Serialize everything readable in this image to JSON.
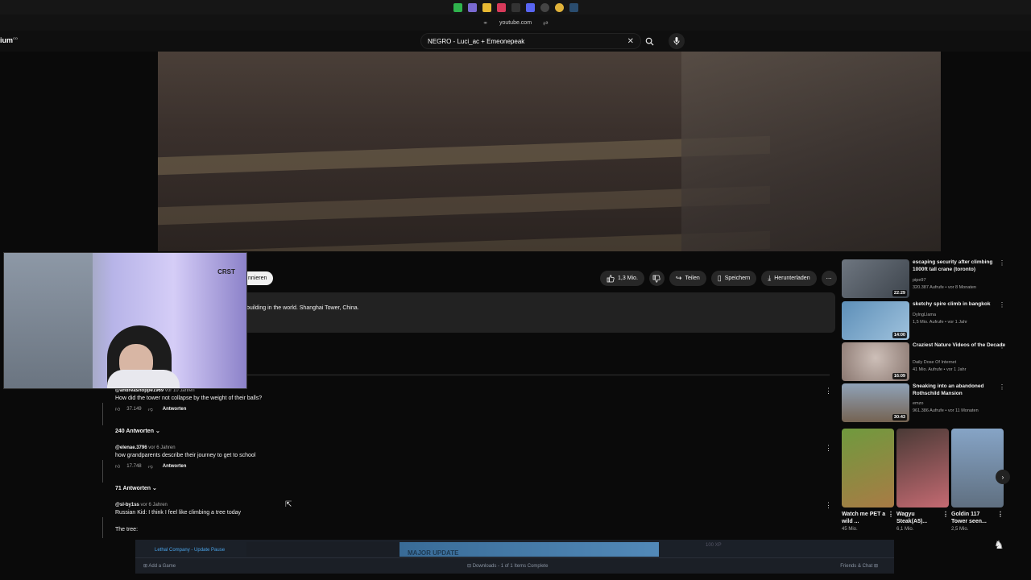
{
  "browser": {
    "url": "youtube.com"
  },
  "header": {
    "logo_fragment": "ium",
    "logo_sup": "CO",
    "search_query": "NEGRO - Luci_ac + Emeonepeak"
  },
  "actions": {
    "subscribe_label": "nnieren",
    "likes": "1,3 Mio.",
    "share": "Teilen",
    "save": "Speichern",
    "download": "Herunterladen"
  },
  "description": "building in the world. Shanghai Tower, China.",
  "webcam": {
    "logo_text": "CRST"
  },
  "comments": [
    {
      "author": "@andreasnoppe1969",
      "time": "vor 10 Jahren",
      "text": "How did the tower not collapse by the weight of their balls?",
      "likes": "37.149",
      "reply": "Antworten",
      "replies": "240 Antworten"
    },
    {
      "author": "@elenae.3796",
      "time": "vor 6 Jahren",
      "text": "how grandparents describe their journey to get to school",
      "likes": "17.748",
      "reply": "Antworten",
      "replies": "71 Antworten"
    },
    {
      "author": "@sl-by1ss",
      "time": "vor 6 Jahren",
      "text": "Russian Kid: I think I feel like climbing a tree today",
      "text2": "The tree:"
    }
  ],
  "sidebar": [
    {
      "title": "escaping security after climbing 1000ft tall crane (toronto)",
      "channel": "pipe97",
      "meta": "320.387 Aufrufe • vor 8 Monaten",
      "duration": "22:29",
      "colors": [
        "#6e7680",
        "#3d444c"
      ]
    },
    {
      "title": "sketchy spire climb in bangkok",
      "channel": "DylngLlama",
      "meta": "1,5 Mio. Aufrufe • vor 1 Jahr",
      "duration": "14:00",
      "colors": [
        "#5d8fb8",
        "#9fc2dd"
      ]
    },
    {
      "title": "Craziest Nature Videos of the Decade",
      "channel": "Daily Dose Of Internet",
      "meta": "41 Mio. Aufrufe • vor 1 Jahr",
      "duration": "16:09",
      "colors": [
        "#cdbfb8",
        "#8a7770"
      ]
    },
    {
      "title": "Sneaking into an abandoned Rothschild Mansion",
      "channel": "emzo",
      "meta": "961.386 Aufrufe • vor 11 Monaten",
      "duration": "30:43",
      "colors": [
        "#8fa2b8",
        "#756352"
      ]
    }
  ],
  "shorts": [
    {
      "title": "Watch me PET a wild ...",
      "views": "45 Mio.",
      "colors": [
        "#6f9a3e",
        "#a97b45"
      ]
    },
    {
      "title": "Wagyu Steak(A5)...",
      "views": "6,1 Mio.",
      "colors": [
        "#4a3a36",
        "#c46a72"
      ]
    },
    {
      "title": "Goldin 117 Tower seen...",
      "views": "2,5 Mio.",
      "colors": [
        "#86a4c6",
        "#5f6f80"
      ]
    }
  ],
  "steam": {
    "news_line": "Lethal Company - Update Pause",
    "banner_text": "MAJOR UPDATE",
    "xp": "100 XP",
    "add_game": "Add a Game",
    "downloads": "Downloads - 1 of 1 Items Complete",
    "friends": "Friends & Chat"
  }
}
